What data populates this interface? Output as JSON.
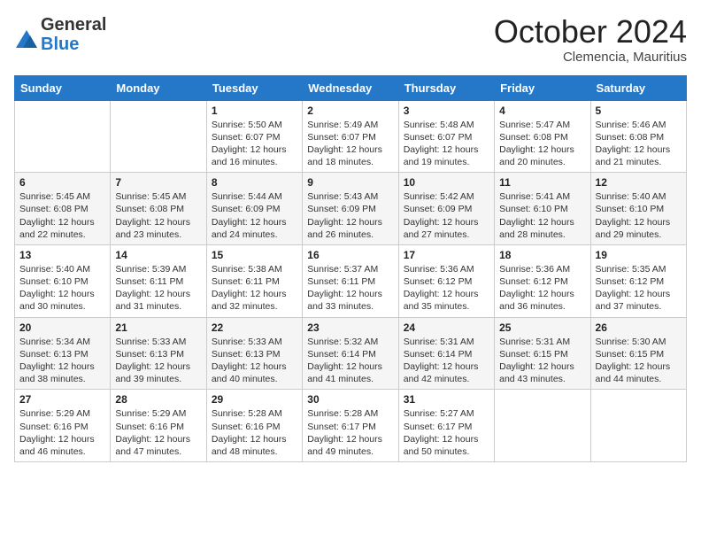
{
  "logo": {
    "general": "General",
    "blue": "Blue"
  },
  "title": "October 2024",
  "subtitle": "Clemencia, Mauritius",
  "headers": [
    "Sunday",
    "Monday",
    "Tuesday",
    "Wednesday",
    "Thursday",
    "Friday",
    "Saturday"
  ],
  "weeks": [
    [
      {
        "day": "",
        "info": ""
      },
      {
        "day": "",
        "info": ""
      },
      {
        "day": "1",
        "info": "Sunrise: 5:50 AM\nSunset: 6:07 PM\nDaylight: 12 hours and 16 minutes."
      },
      {
        "day": "2",
        "info": "Sunrise: 5:49 AM\nSunset: 6:07 PM\nDaylight: 12 hours and 18 minutes."
      },
      {
        "day": "3",
        "info": "Sunrise: 5:48 AM\nSunset: 6:07 PM\nDaylight: 12 hours and 19 minutes."
      },
      {
        "day": "4",
        "info": "Sunrise: 5:47 AM\nSunset: 6:08 PM\nDaylight: 12 hours and 20 minutes."
      },
      {
        "day": "5",
        "info": "Sunrise: 5:46 AM\nSunset: 6:08 PM\nDaylight: 12 hours and 21 minutes."
      }
    ],
    [
      {
        "day": "6",
        "info": "Sunrise: 5:45 AM\nSunset: 6:08 PM\nDaylight: 12 hours and 22 minutes."
      },
      {
        "day": "7",
        "info": "Sunrise: 5:45 AM\nSunset: 6:08 PM\nDaylight: 12 hours and 23 minutes."
      },
      {
        "day": "8",
        "info": "Sunrise: 5:44 AM\nSunset: 6:09 PM\nDaylight: 12 hours and 24 minutes."
      },
      {
        "day": "9",
        "info": "Sunrise: 5:43 AM\nSunset: 6:09 PM\nDaylight: 12 hours and 26 minutes."
      },
      {
        "day": "10",
        "info": "Sunrise: 5:42 AM\nSunset: 6:09 PM\nDaylight: 12 hours and 27 minutes."
      },
      {
        "day": "11",
        "info": "Sunrise: 5:41 AM\nSunset: 6:10 PM\nDaylight: 12 hours and 28 minutes."
      },
      {
        "day": "12",
        "info": "Sunrise: 5:40 AM\nSunset: 6:10 PM\nDaylight: 12 hours and 29 minutes."
      }
    ],
    [
      {
        "day": "13",
        "info": "Sunrise: 5:40 AM\nSunset: 6:10 PM\nDaylight: 12 hours and 30 minutes."
      },
      {
        "day": "14",
        "info": "Sunrise: 5:39 AM\nSunset: 6:11 PM\nDaylight: 12 hours and 31 minutes."
      },
      {
        "day": "15",
        "info": "Sunrise: 5:38 AM\nSunset: 6:11 PM\nDaylight: 12 hours and 32 minutes."
      },
      {
        "day": "16",
        "info": "Sunrise: 5:37 AM\nSunset: 6:11 PM\nDaylight: 12 hours and 33 minutes."
      },
      {
        "day": "17",
        "info": "Sunrise: 5:36 AM\nSunset: 6:12 PM\nDaylight: 12 hours and 35 minutes."
      },
      {
        "day": "18",
        "info": "Sunrise: 5:36 AM\nSunset: 6:12 PM\nDaylight: 12 hours and 36 minutes."
      },
      {
        "day": "19",
        "info": "Sunrise: 5:35 AM\nSunset: 6:12 PM\nDaylight: 12 hours and 37 minutes."
      }
    ],
    [
      {
        "day": "20",
        "info": "Sunrise: 5:34 AM\nSunset: 6:13 PM\nDaylight: 12 hours and 38 minutes."
      },
      {
        "day": "21",
        "info": "Sunrise: 5:33 AM\nSunset: 6:13 PM\nDaylight: 12 hours and 39 minutes."
      },
      {
        "day": "22",
        "info": "Sunrise: 5:33 AM\nSunset: 6:13 PM\nDaylight: 12 hours and 40 minutes."
      },
      {
        "day": "23",
        "info": "Sunrise: 5:32 AM\nSunset: 6:14 PM\nDaylight: 12 hours and 41 minutes."
      },
      {
        "day": "24",
        "info": "Sunrise: 5:31 AM\nSunset: 6:14 PM\nDaylight: 12 hours and 42 minutes."
      },
      {
        "day": "25",
        "info": "Sunrise: 5:31 AM\nSunset: 6:15 PM\nDaylight: 12 hours and 43 minutes."
      },
      {
        "day": "26",
        "info": "Sunrise: 5:30 AM\nSunset: 6:15 PM\nDaylight: 12 hours and 44 minutes."
      }
    ],
    [
      {
        "day": "27",
        "info": "Sunrise: 5:29 AM\nSunset: 6:16 PM\nDaylight: 12 hours and 46 minutes."
      },
      {
        "day": "28",
        "info": "Sunrise: 5:29 AM\nSunset: 6:16 PM\nDaylight: 12 hours and 47 minutes."
      },
      {
        "day": "29",
        "info": "Sunrise: 5:28 AM\nSunset: 6:16 PM\nDaylight: 12 hours and 48 minutes."
      },
      {
        "day": "30",
        "info": "Sunrise: 5:28 AM\nSunset: 6:17 PM\nDaylight: 12 hours and 49 minutes."
      },
      {
        "day": "31",
        "info": "Sunrise: 5:27 AM\nSunset: 6:17 PM\nDaylight: 12 hours and 50 minutes."
      },
      {
        "day": "",
        "info": ""
      },
      {
        "day": "",
        "info": ""
      }
    ]
  ]
}
